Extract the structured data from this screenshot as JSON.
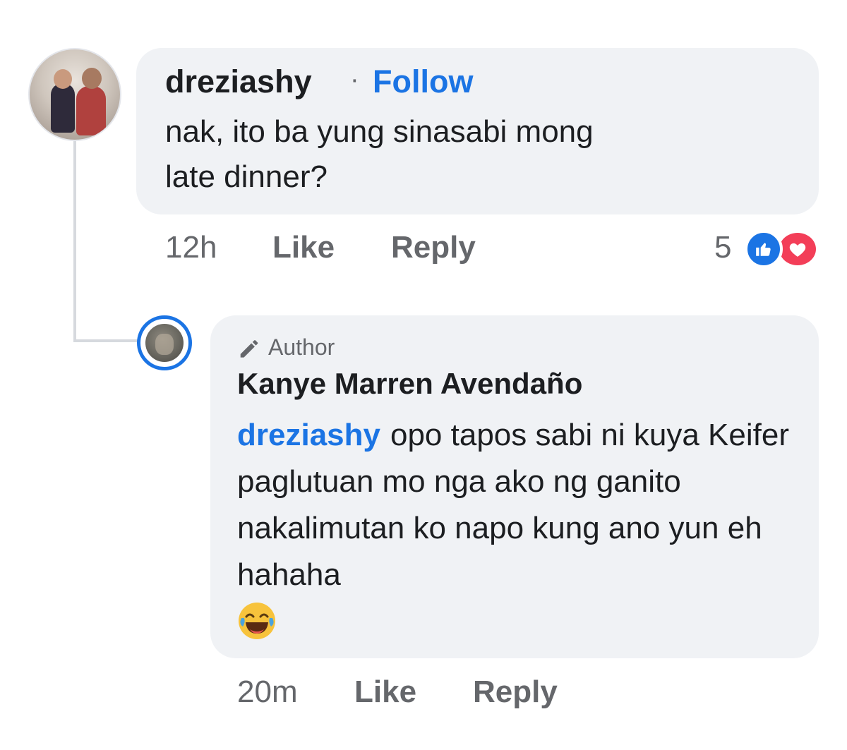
{
  "comment": {
    "author": "dreziashy",
    "separator": "·",
    "follow_label": "Follow",
    "text": "nak, ito ba yung sinasabi mong\nlate dinner?",
    "time": "12h",
    "like_label": "Like",
    "reply_label": "Reply",
    "reaction_count": "5",
    "reactions": [
      "like-icon",
      "love-icon"
    ]
  },
  "reply": {
    "badge_label": "Author",
    "author": "Kanye Marren Avendaño",
    "mention": "dreziashy",
    "text": "opo tapos sabi ni kuya Keifer paglutuan mo nga ako ng ganito nakalimutan ko napo kung ano yun eh hahaha",
    "emoji": "laughing-emoji",
    "time": "20m",
    "like_label": "Like",
    "reply_label": "Reply"
  },
  "colors": {
    "bubble": "#f0f2f5",
    "link": "#1b74e4",
    "meta": "#65676b",
    "love": "#f33e58"
  }
}
